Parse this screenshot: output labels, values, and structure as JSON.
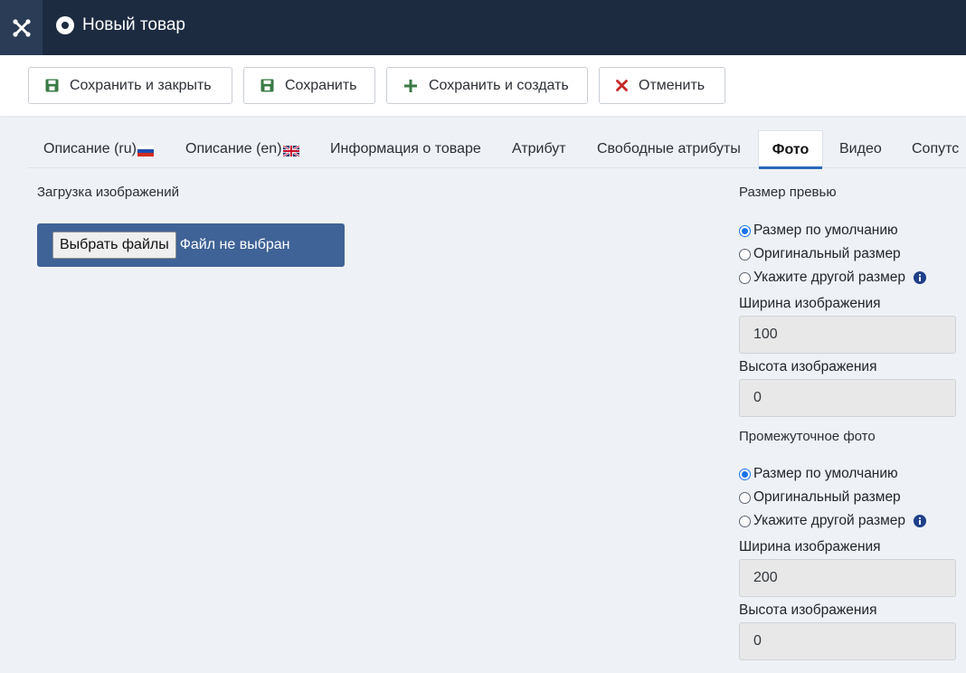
{
  "header": {
    "title": "Новый товар",
    "logo_icon": "joomla-icon"
  },
  "toolbar": {
    "save_close": "Сохранить и закрыть",
    "save": "Сохранить",
    "save_new": "Сохранить и создать",
    "cancel": "Отменить"
  },
  "tabs": [
    {
      "label": "Описание (ru)"
    },
    {
      "label": "Описание (en)"
    },
    {
      "label": "Информация о товаре"
    },
    {
      "label": "Атрибут"
    },
    {
      "label": "Свободные атрибуты"
    },
    {
      "label": "Фото"
    },
    {
      "label": "Видео"
    },
    {
      "label": "Сопутс"
    }
  ],
  "upload": {
    "label": "Загрузка изображений",
    "button": "Выбрать файлы",
    "status": "Файл не выбран"
  },
  "preview": {
    "title": "Размер превью",
    "options": [
      "Размер по умолчанию",
      "Оригинальный размер",
      "Укажите другой размер"
    ],
    "width_label": "Ширина изображения",
    "width_value": "100",
    "height_label": "Высота изображения",
    "height_value": "0"
  },
  "medium": {
    "title": "Промежуточное фото",
    "options": [
      "Размер по умолчанию",
      "Оригинальный размер",
      "Укажите другой размер"
    ],
    "width_label": "Ширина изображения",
    "width_value": "200",
    "height_label": "Высота изображения",
    "height_value": "0"
  },
  "colors": {
    "topbar": "#1c2b40",
    "upload_box": "#3f6396",
    "save_icon": "#3a7a45",
    "cancel_icon": "#c62828",
    "active_tab_underline": "#2a69b8"
  }
}
